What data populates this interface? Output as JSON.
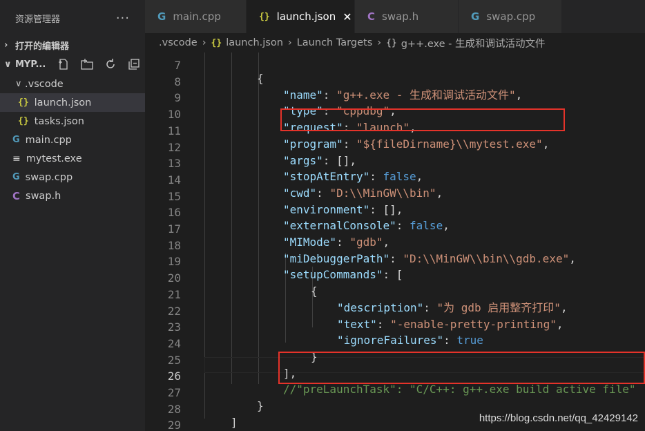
{
  "sidebar": {
    "title": "资源管理器",
    "more": "···",
    "open_editors": "打开的编辑器",
    "folder": "MYP...",
    "tree": [
      {
        "label": ".vscode",
        "icon": "folder-open",
        "chevron": "∨"
      },
      {
        "label": "launch.json",
        "icon": "json-icon"
      },
      {
        "label": "tasks.json",
        "icon": "json-icon"
      },
      {
        "label": "main.cpp",
        "icon": "cpp-icon"
      },
      {
        "label": "mytest.exe",
        "icon": "exe-icon"
      },
      {
        "label": "swap.cpp",
        "icon": "cpp-icon"
      },
      {
        "label": "swap.h",
        "icon": "c-header-icon"
      }
    ]
  },
  "tabs": [
    {
      "label": "main.cpp",
      "icon": "cpp-icon"
    },
    {
      "label": "launch.json",
      "icon": "json-icon",
      "active": true
    },
    {
      "label": "swap.h",
      "icon": "c-header-icon"
    },
    {
      "label": "swap.cpp",
      "icon": "cpp-icon"
    }
  ],
  "breadcrumb": {
    "folder": ".vscode",
    "file": "launch.json",
    "section": "Launch Targets",
    "item": "g++.exe - 生成和调试活动文件"
  },
  "editor": {
    "line_numbers": [
      "7",
      "8",
      "9",
      "10",
      "11",
      "12",
      "13",
      "14",
      "15",
      "16",
      "17",
      "18",
      "19",
      "20",
      "21",
      "22",
      "23",
      "24",
      "25",
      "26",
      "27",
      "28",
      "29"
    ],
    "current_line": "26"
  },
  "colors": {
    "key": "#9cdcfe",
    "string": "#ce9178",
    "bool": "#569cd6",
    "comment": "#6a9955",
    "highlight_box": "#e5332a"
  },
  "watermark": "https://blog.csdn.net/qq_42429142"
}
